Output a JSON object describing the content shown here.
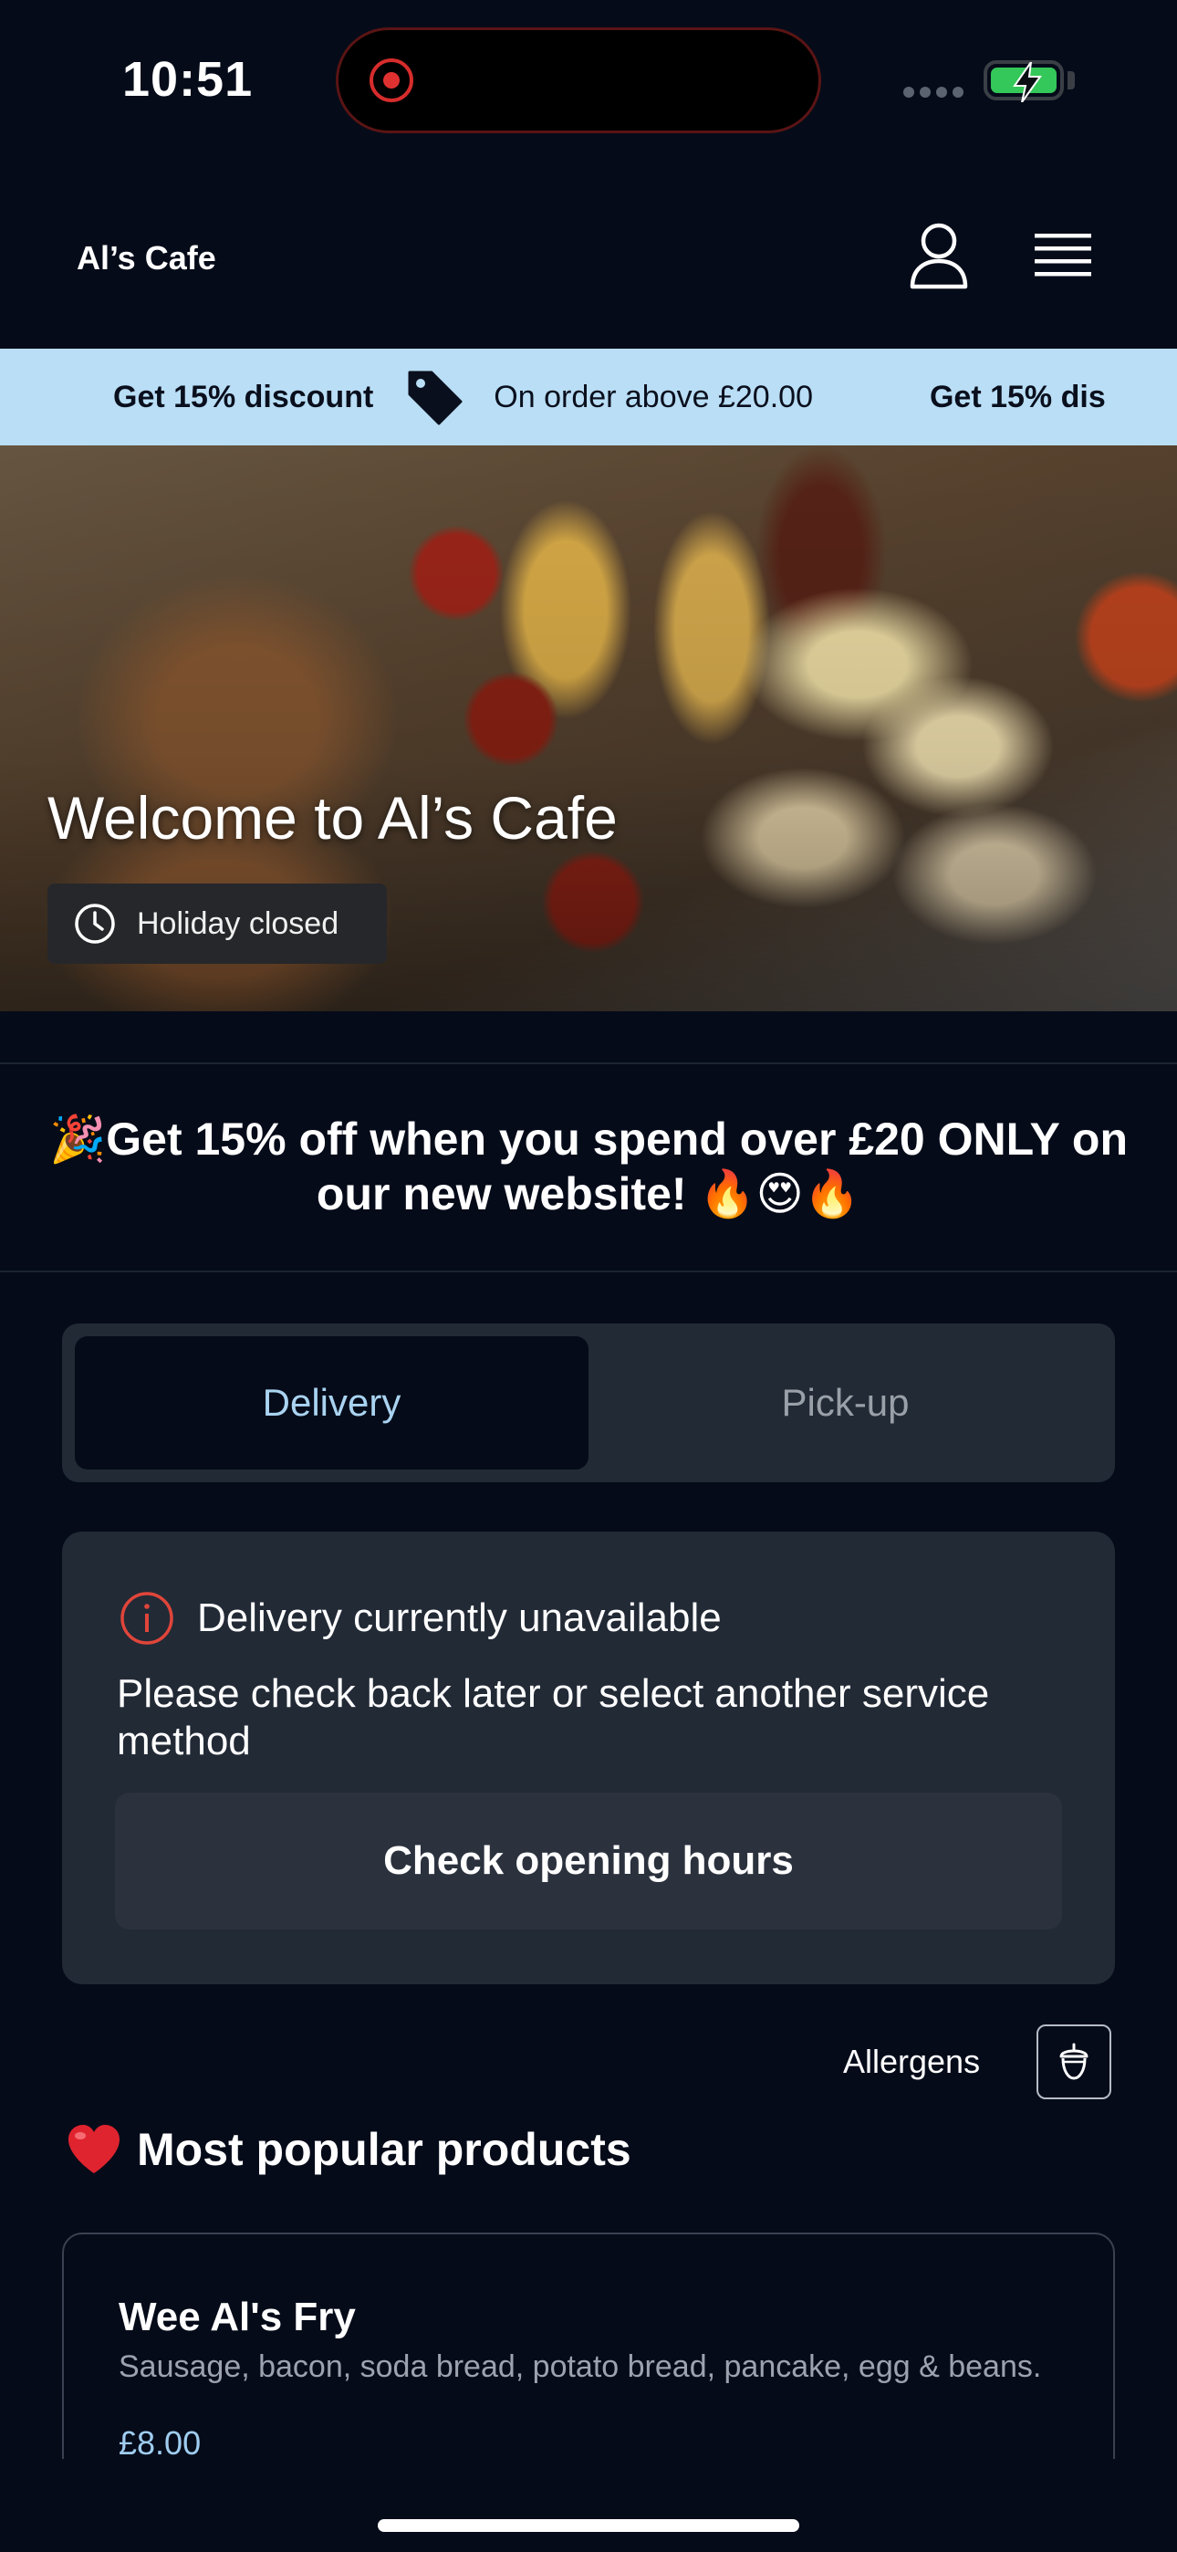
{
  "status_bar": {
    "time": "10:51"
  },
  "header": {
    "cafe_name": "Al’s Cafe",
    "icons": [
      "account-icon",
      "menu-icon"
    ]
  },
  "promo_banner": {
    "headline": "Get 15% discount",
    "detail": "On order above £20.00",
    "headline_repeat": "Get 15% dis"
  },
  "hero": {
    "title": "Welcome to Al’s Cafe",
    "status": "Holiday closed"
  },
  "announcement": {
    "line1": "🎉Get 15% off when you spend over £20 ONLY on",
    "line2": "our new website! 🔥😍🔥"
  },
  "service_toggle": {
    "options": [
      {
        "label": "Delivery",
        "selected": true
      },
      {
        "label": "Pick-up",
        "selected": false
      }
    ]
  },
  "notice": {
    "title": "Delivery currently unavailable",
    "body": "Please check back later or select another service method",
    "button": "Check opening hours"
  },
  "allergens": {
    "label": "Allergens"
  },
  "popular": {
    "title": "Most popular products",
    "products": [
      {
        "name": "Wee Al's Fry",
        "description": "Sausage, bacon, soda bread, potato bread, pancake, egg & beans.",
        "price": "£8.00"
      }
    ]
  },
  "colors": {
    "background": "#050b19",
    "card": "#222a36",
    "banner": "#b9def5",
    "accent": "#a9d3f0",
    "alert": "#e0453a"
  }
}
